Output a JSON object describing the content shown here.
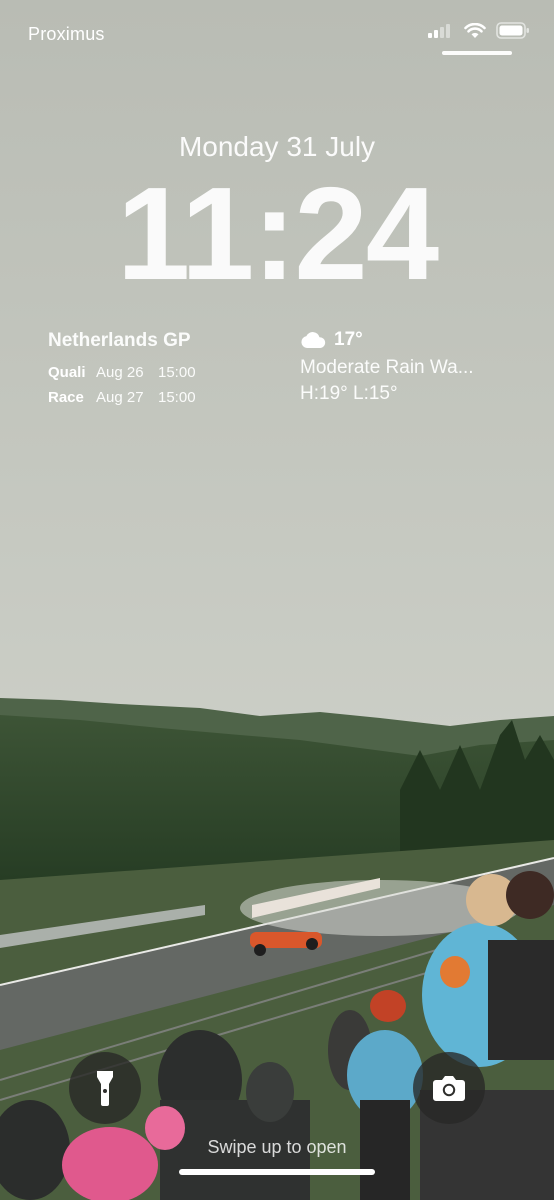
{
  "status_bar": {
    "carrier": "Proximus"
  },
  "lock_screen": {
    "date": "Monday 31 July",
    "time": "11:24"
  },
  "gp_widget": {
    "title": "Netherlands GP",
    "sessions": [
      {
        "label": "Quali",
        "date": "Aug 26",
        "time": "15:00"
      },
      {
        "label": "Race",
        "date": "Aug 27",
        "time": "15:00"
      }
    ]
  },
  "weather_widget": {
    "icon": "cloud-icon",
    "temperature": "17°",
    "description": "Moderate Rain Wa...",
    "range": "H:19° L:15°"
  },
  "controls": {
    "flashlight_icon": "flashlight-icon",
    "camera_icon": "camera-icon",
    "swipe_text": "Swipe up to open"
  },
  "colors": {
    "sky": "#c9cbc4",
    "forest": "#2f4a2c",
    "track": "#5b5e5a"
  }
}
